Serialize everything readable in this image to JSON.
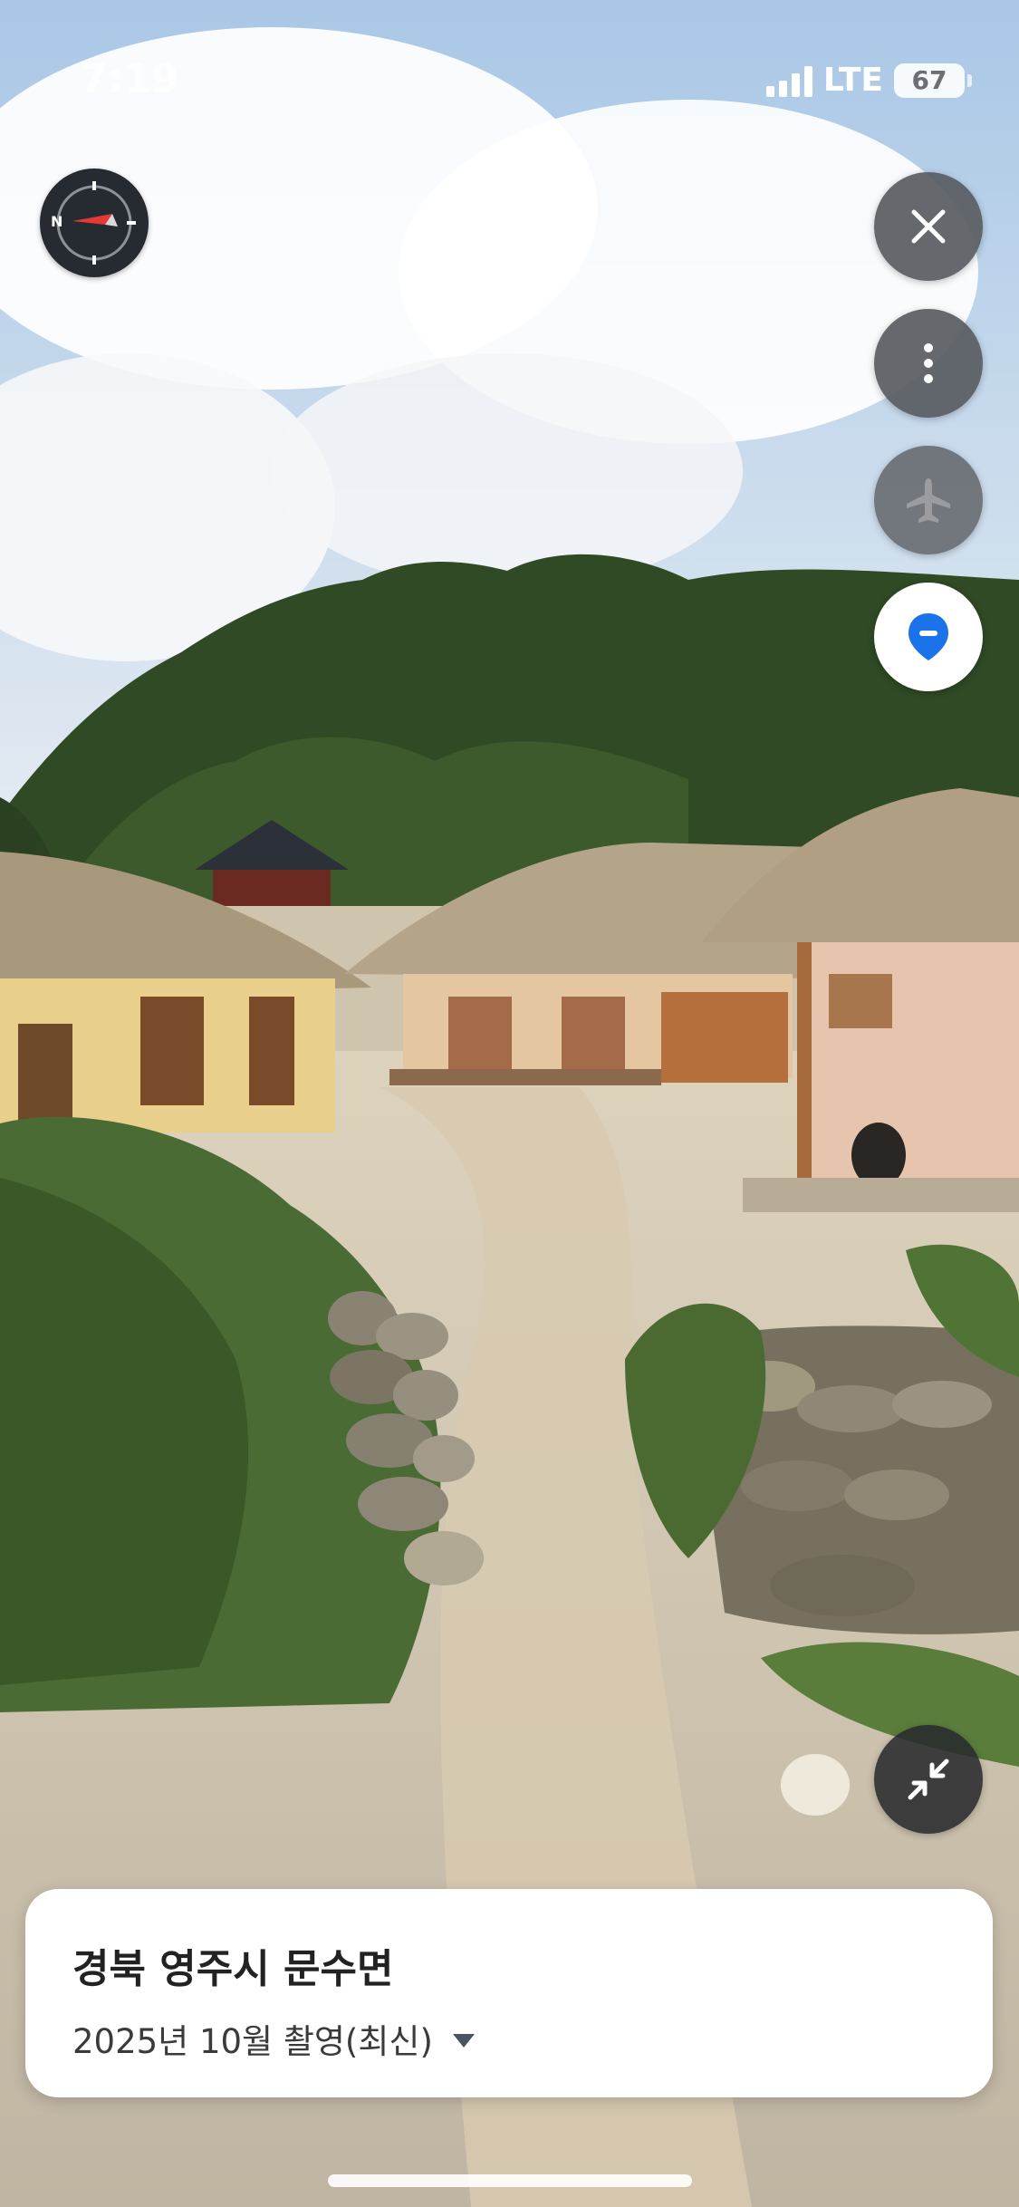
{
  "status_bar": {
    "time": "7:19",
    "network": "LTE",
    "battery": "67"
  },
  "location_card": {
    "title": "경북 영주시 문수면",
    "capture_date": "2025년 10월 촬영(최신)"
  },
  "controls": {
    "compass_north_label": "N"
  },
  "colors": {
    "accent_blue": "#1a73e8",
    "button_gray": "#585c61",
    "compass_red": "#e53935"
  }
}
